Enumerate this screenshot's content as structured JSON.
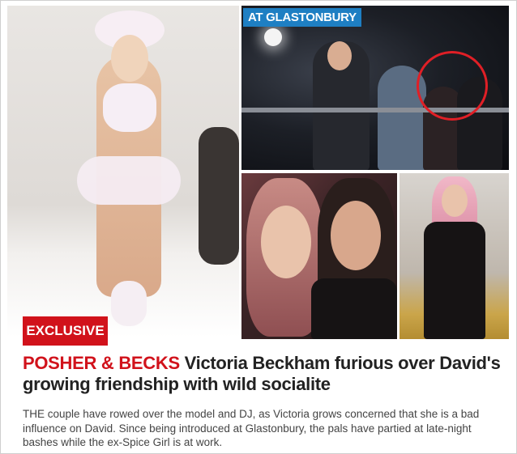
{
  "photos": {
    "runway": {
      "description": ""
    },
    "glastonbury": {
      "tag": "AT GLASTONBURY"
    },
    "selfie": {},
    "portrait": {}
  },
  "badge": {
    "label": "EXCLUSIVE"
  },
  "headline": {
    "kicker": "POSHER & BECKS",
    "title": "Victoria Beckham furious over David's growing friendship with wild socialite"
  },
  "body": {
    "text": "THE couple have rowed over the model and DJ, as Victoria grows concerned that she is a bad influence on David. Since being introduced at Glastonbury, the pals have partied at late-night bashes while the ex-Spice Girl is at work."
  },
  "colors": {
    "accent": "#d1121b",
    "tag_blue": "#1e7fc3"
  }
}
